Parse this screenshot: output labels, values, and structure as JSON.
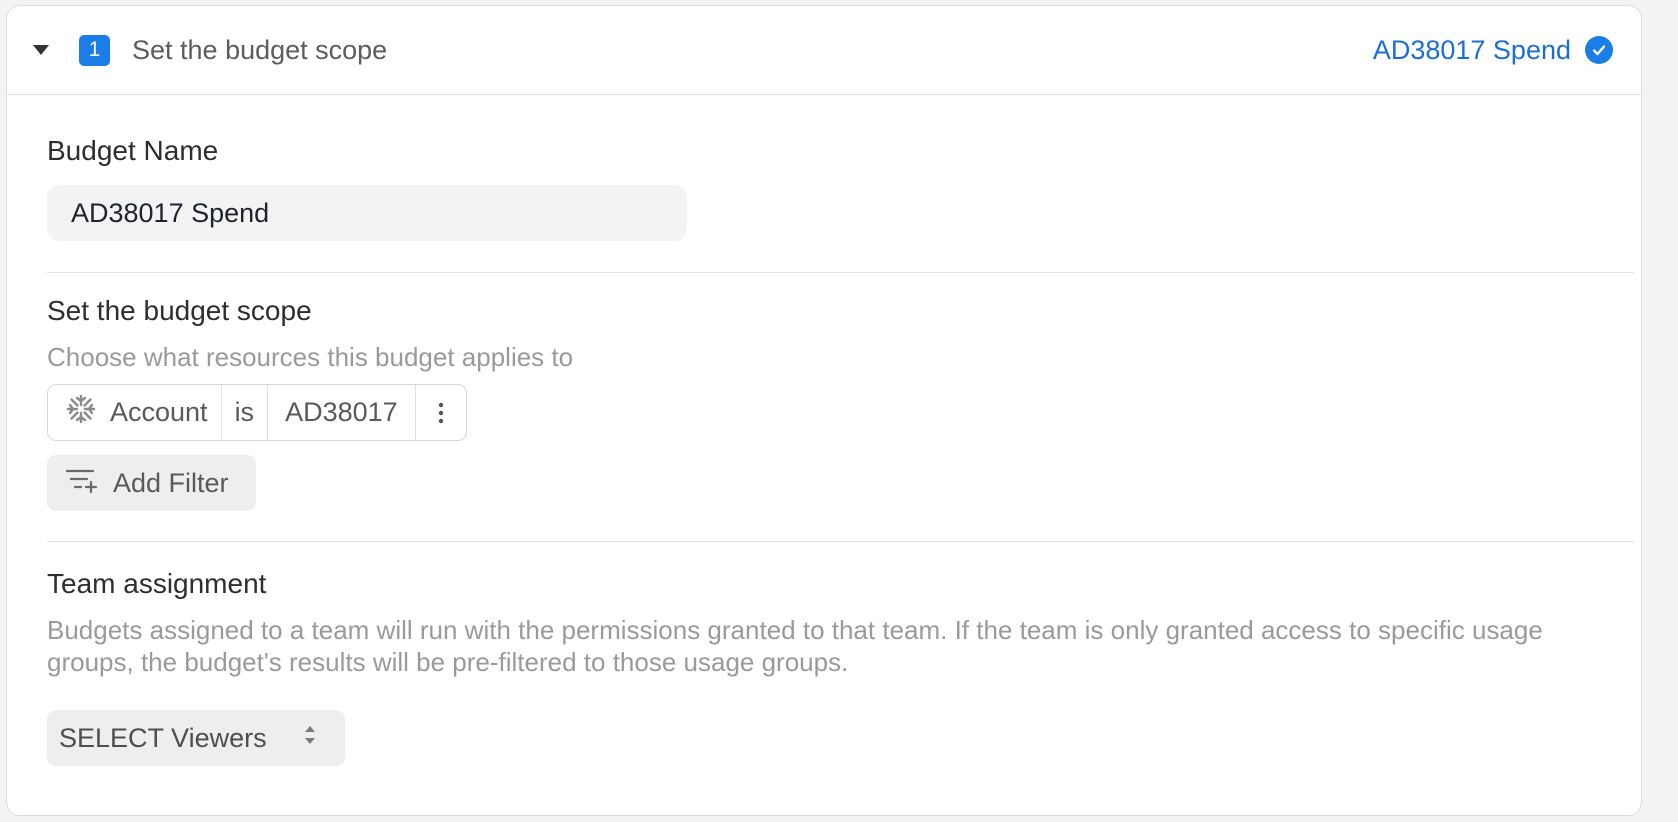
{
  "step": {
    "number": "1",
    "title": "Set the budget scope",
    "summary": "AD38017 Spend"
  },
  "budget_name": {
    "label": "Budget Name",
    "value": "AD38017 Spend"
  },
  "scope": {
    "title": "Set the budget scope",
    "description": "Choose what resources this budget applies to",
    "filter": {
      "field": "Account",
      "operator": "is",
      "value": "AD38017"
    },
    "add_filter_label": "Add Filter"
  },
  "team": {
    "title": "Team assignment",
    "description": "Budgets assigned to a team will run with the permissions granted to that team. If the team is only granted access to specific usage groups, the budget's results will be pre-filtered to those usage groups.",
    "select_label": "SELECT Viewers"
  },
  "icons": {
    "collapse": "caret-down-icon",
    "complete": "check-circle-icon",
    "filter_field": "snowflake-icon",
    "filter_menu": "more-vertical-icon",
    "add_filter": "filter-add-icon",
    "select": "sort-arrows-icon"
  },
  "colors": {
    "accent": "#1a7de8",
    "summary_link": "#1a6fd6",
    "muted_text": "#9a9a9a"
  }
}
